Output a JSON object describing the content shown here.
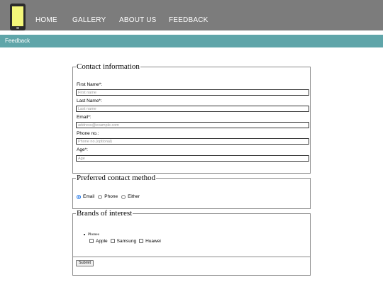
{
  "nav": {
    "logo_icon": "phone-icon",
    "items": [
      "HOME",
      "GALLERY",
      "ABOUT US",
      "FEEDBACK"
    ]
  },
  "banner": {
    "title": "Feedback"
  },
  "contact": {
    "legend": "Contact information",
    "fields": [
      {
        "label": "First Name*:",
        "placeholder": "First name"
      },
      {
        "label": "Last Name*:",
        "placeholder": "Last name"
      },
      {
        "label": "Email*:",
        "placeholder": "address@example.com"
      },
      {
        "label": "Phone no.:",
        "placeholder": "Phone no.(optional)"
      },
      {
        "label": "Age*:",
        "placeholder": "Age"
      }
    ]
  },
  "method": {
    "legend": "Preferred contact method",
    "options": [
      "Email",
      "Phone",
      "Either"
    ],
    "selected": "Email"
  },
  "brands": {
    "legend": "Brands of interest",
    "category": "Phones",
    "options": [
      "Apple",
      "Samsung",
      "Huawei"
    ]
  },
  "submit_label": "Submit",
  "colors": {
    "nav_bg": "#7c7c7c",
    "banner_bg": "#5fa5a9",
    "radio_accent": "#1a73e8"
  }
}
